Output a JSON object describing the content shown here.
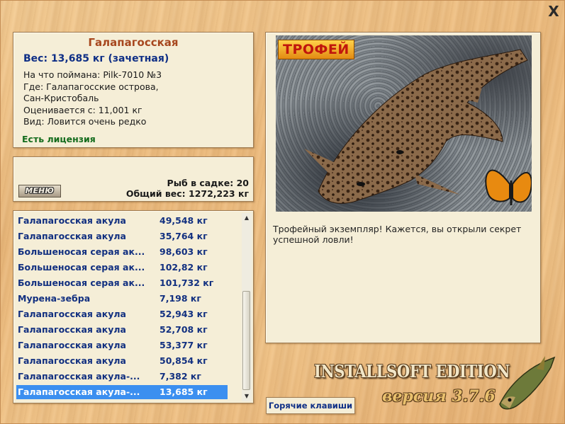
{
  "window": {
    "close_label": "X"
  },
  "info": {
    "title": "Галапагосская",
    "weight": "Вес: 13,685 кг (зачетная)",
    "caught_on": "На что поймана: Pilk-7010 №3",
    "location_line1": "Где: Галапагосские острова,",
    "location_line2": "Сан-Кристобаль",
    "valued_from": "Оценивается с: 11,001 кг",
    "kind": "Вид: Ловится очень редко",
    "license": "Есть лицензия"
  },
  "stats": {
    "menu_label": "МЕНЮ",
    "fish_in_keepnet": "Рыб в садке: 20",
    "total_weight": "Общий вес: 1272,223 кг"
  },
  "catch_list": [
    {
      "name": "Галапагосская акула",
      "weight": "49,548 кг"
    },
    {
      "name": "Галапагосская акула",
      "weight": "35,764 кг"
    },
    {
      "name": "Большеносая серая ак...",
      "weight": "98,603 кг"
    },
    {
      "name": "Большеносая серая ак...",
      "weight": "102,82 кг"
    },
    {
      "name": "Большеносая серая ак...",
      "weight": "101,732 кг"
    },
    {
      "name": "Мурена-зебра",
      "weight": "7,198 кг"
    },
    {
      "name": "Галапагосская акула",
      "weight": "52,943 кг"
    },
    {
      "name": "Галапагосская акула",
      "weight": "52,708 кг"
    },
    {
      "name": "Галапагосская акула",
      "weight": "53,377 кг"
    },
    {
      "name": "Галапагосская акула",
      "weight": "50,854 кг"
    },
    {
      "name": "Галапагосская акула-...",
      "weight": "7,382 кг"
    },
    {
      "name": "Галапагосская акула-...",
      "weight": "13,685 кг",
      "selected": true
    }
  ],
  "photo": {
    "badge": "ТРОФЕЙ",
    "caption": "Трофейный экземпляр! Кажется, вы открыли секрет успешной ловли!"
  },
  "footer": {
    "hotkeys_label": "Горячие клавиши",
    "edition": "INSTALLSOFT EDITION",
    "version": "версия 3.7.6"
  },
  "colors": {
    "title": "#a7471e",
    "weight": "#0f2f86",
    "license": "#146c1d",
    "list_text": "#123080",
    "selection": "#3b8ff0"
  }
}
